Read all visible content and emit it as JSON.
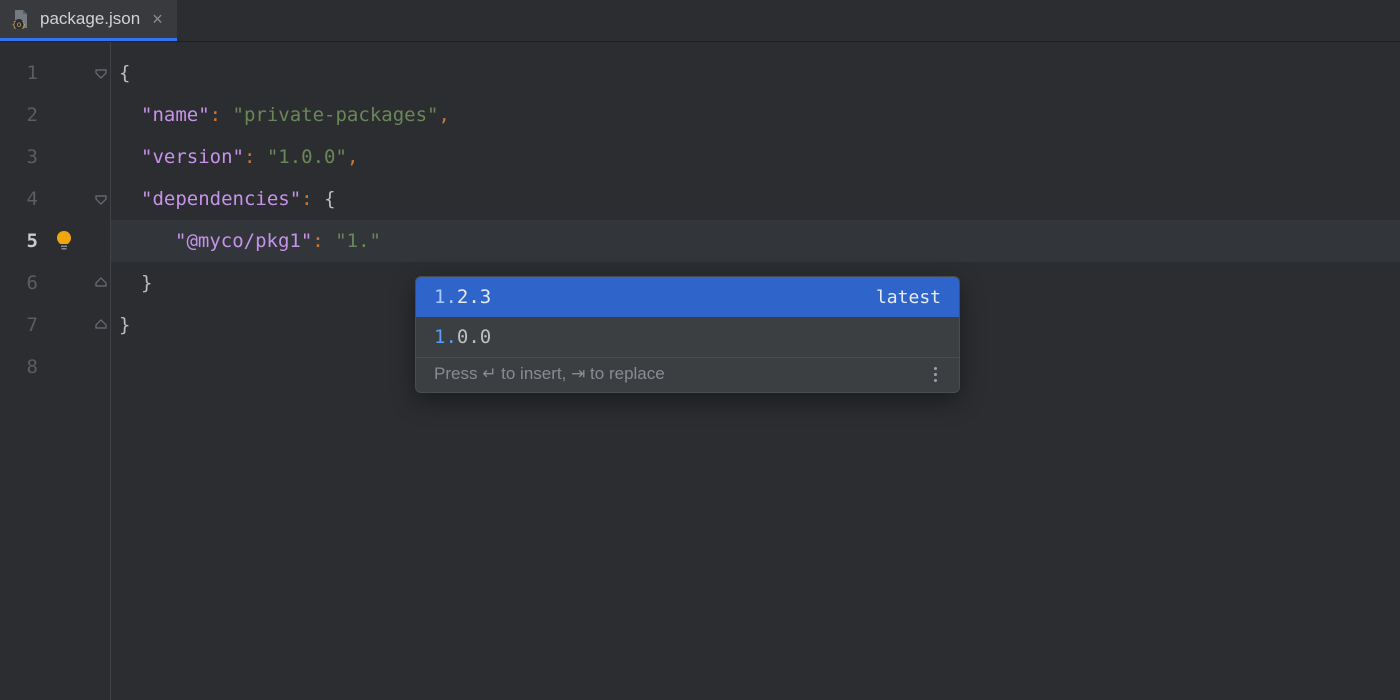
{
  "tab": {
    "filename": "package.json"
  },
  "gutter": {
    "lines": [
      "1",
      "2",
      "3",
      "4",
      "5",
      "6",
      "7",
      "8"
    ]
  },
  "code": {
    "line1_brace": "{",
    "line2_key": "\"name\"",
    "line2_val": "\"private-packages\"",
    "line2_comma": ",",
    "line3_key": "\"version\"",
    "line3_val": "\"1.0.0\"",
    "line3_comma": ",",
    "line4_key": "\"dependencies\"",
    "line4_brace": "{",
    "line5_key": "\"@myco/pkg1\"",
    "line5_val": "\"1.\"",
    "line6_brace": "}",
    "line7_brace": "}",
    "colon": ":"
  },
  "completion": {
    "items": [
      {
        "match": "1.",
        "rest": "2.3",
        "right": "latest"
      },
      {
        "match": "1.",
        "rest": "0.0",
        "right": ""
      }
    ],
    "hint_prefix": "Press ",
    "hint_mid": " to insert, ",
    "hint_suffix": " to replace"
  }
}
